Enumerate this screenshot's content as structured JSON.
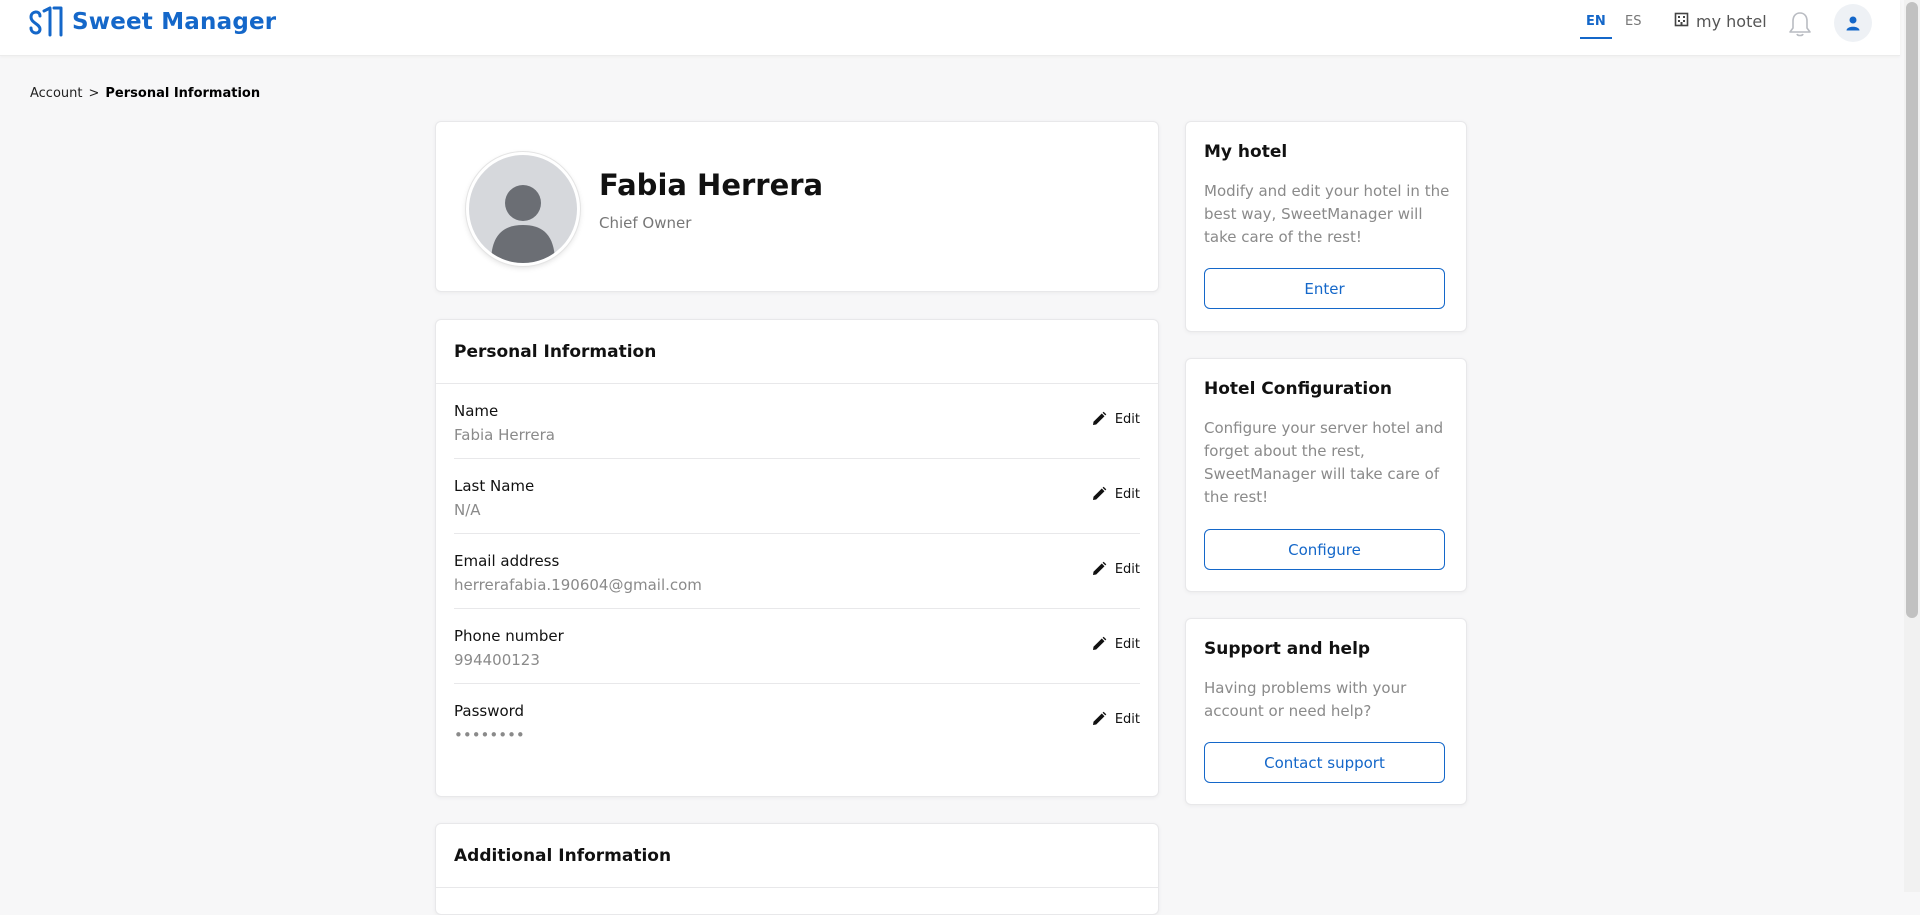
{
  "header": {
    "logo_text": "Sweet Manager",
    "lang_en": "EN",
    "lang_es": "ES",
    "hotel_link": "my hotel",
    "icons": [
      "logo-icon",
      "hotel-icon",
      "bell-icon",
      "user-icon"
    ],
    "accent_color": "#1467c9"
  },
  "breadcrumb": {
    "root": "Account",
    "separator": ">",
    "current": "Personal Information"
  },
  "profile": {
    "name": "Fabia Herrera",
    "role": "Chief Owner"
  },
  "personal_info": {
    "title": "Personal Information",
    "edit_label": "Edit",
    "rows": [
      {
        "label": "Name",
        "value": "Fabia Herrera"
      },
      {
        "label": "Last Name",
        "value": "N/A"
      },
      {
        "label": "Email address",
        "value": "herrerafabia.190604@gmail.com"
      },
      {
        "label": "Phone number",
        "value": "994400123"
      },
      {
        "label": "Password",
        "value": "••••••••"
      }
    ]
  },
  "additional_info": {
    "title": "Additional Information"
  },
  "sidebar": {
    "my_hotel": {
      "title": "My hotel",
      "description": "Modify and edit your hotel in the best way, SweetManager will take care of the rest!",
      "button": "Enter"
    },
    "hotel_config": {
      "title": "Hotel Configuration",
      "description": "Configure your server hotel and forget about the rest, SweetManager will take care of the rest!",
      "button": "Configure"
    },
    "support": {
      "title": "Support and help",
      "description": "Having problems with your account or need help?",
      "button": "Contact support"
    }
  }
}
